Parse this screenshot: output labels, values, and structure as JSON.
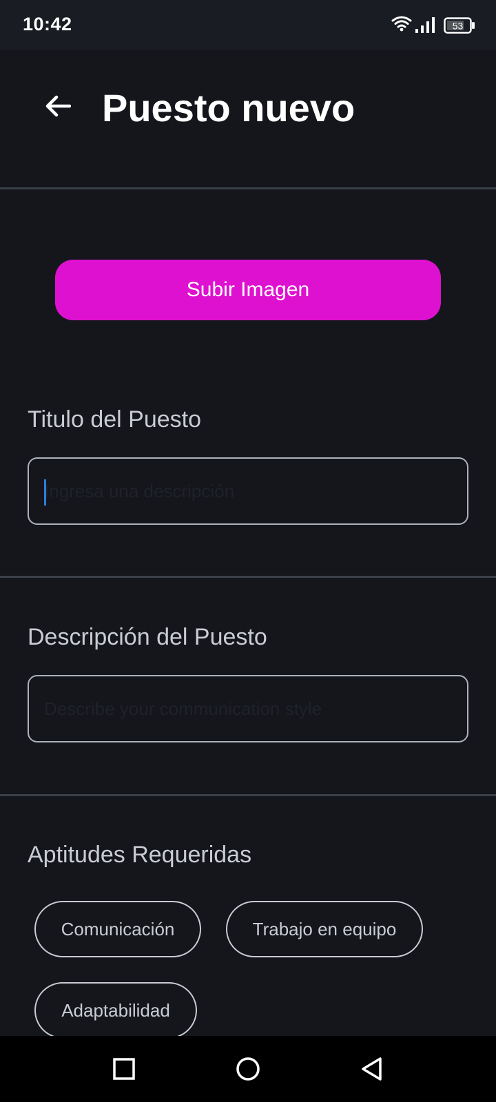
{
  "status_bar": {
    "time": "10:42",
    "battery_level": "53",
    "icons": [
      "wifi-icon",
      "signal-icon",
      "battery-icon"
    ]
  },
  "header": {
    "back_icon": "arrow-left-icon",
    "title": "Puesto nuevo"
  },
  "upload": {
    "label": "Subir Imagen",
    "color": "#dd11cf"
  },
  "title_field": {
    "label": "Titulo del Puesto",
    "placeholder": "Ingresa una descripción",
    "value": ""
  },
  "description_field": {
    "label": "Descripción del Puesto",
    "placeholder": "Describe your communication style",
    "value": ""
  },
  "skills": {
    "label": "Aptitudes Requeridas",
    "chips": [
      "Comunicación",
      "Trabajo en equipo",
      "Adaptabilidad"
    ]
  },
  "nav_bar": {
    "icons": [
      "square-icon",
      "circle-icon",
      "triangle-back-icon"
    ]
  },
  "colors": {
    "background": "#14161b",
    "accent": "#dd11cf",
    "divider": "#3b4048",
    "label": "#c9ccd2"
  }
}
